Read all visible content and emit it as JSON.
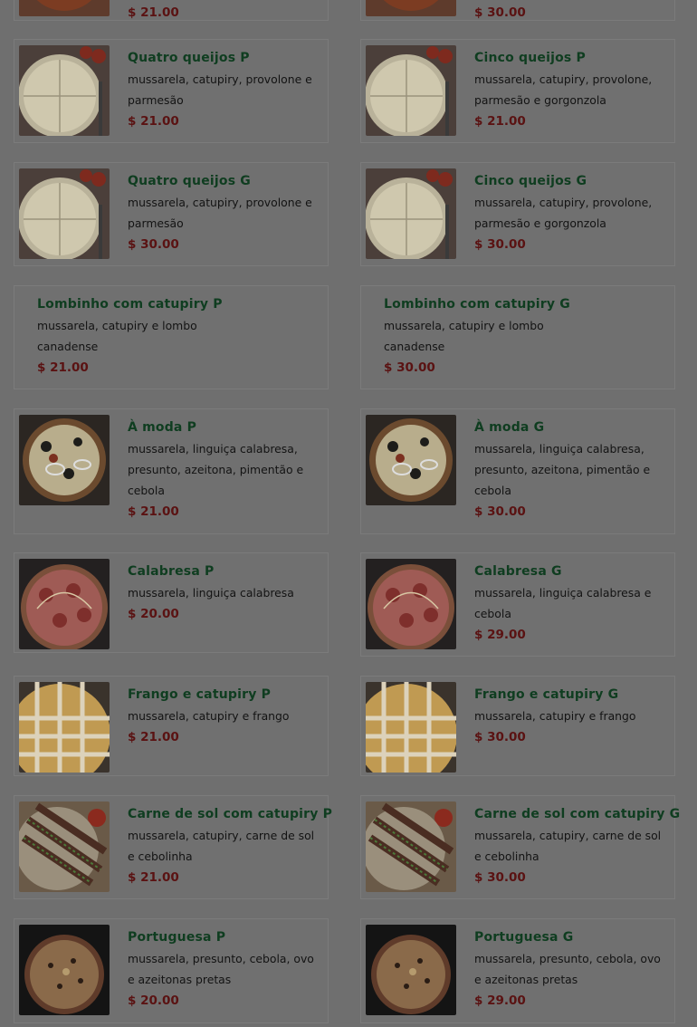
{
  "menu": {
    "items": [
      {
        "name": "",
        "desc": "",
        "price": "$ 21.00",
        "image": "pizza-tomato"
      },
      {
        "name": "",
        "desc": "",
        "price": "$ 30.00",
        "image": "pizza-tomato"
      },
      {
        "name": "Quatro queijos P",
        "desc": "mussarela, catupiry, provolone e parmesão",
        "price": "$ 21.00",
        "image": "pizza-cheese"
      },
      {
        "name": "Cinco queijos P",
        "desc": "mussarela, catupiry, provolone, parmesão e gorgonzola",
        "price": "$ 21.00",
        "image": "pizza-cheese"
      },
      {
        "name": "Quatro queijos G",
        "desc": "mussarela, catupiry, provolone e parmesão",
        "price": "$ 30.00",
        "image": "pizza-cheese"
      },
      {
        "name": "Cinco queijos G",
        "desc": "mussarela, catupiry, provolone, parmesão e gorgonzola",
        "price": "$ 30.00",
        "image": "pizza-cheese"
      },
      {
        "name": "Lombinho com catupiry P",
        "desc": "mussarela, catupiry e lombo canadense",
        "price": "$ 21.00",
        "image": ""
      },
      {
        "name": "Lombinho com catupiry G",
        "desc": "mussarela, catupiry e lombo canadense",
        "price": "$ 30.00",
        "image": ""
      },
      {
        "name": "À moda P",
        "desc": "mussarela, linguiça calabresa, presunto, azeitona, pimentão e cebola",
        "price": "$ 21.00",
        "image": "pizza-moda"
      },
      {
        "name": "À moda G",
        "desc": "mussarela, linguiça calabresa, presunto, azeitona, pimentão e cebola",
        "price": "$ 30.00",
        "image": "pizza-moda"
      },
      {
        "name": "Calabresa P",
        "desc": "mussarela, linguiça calabresa",
        "price": "$ 20.00",
        "image": "pizza-calabresa"
      },
      {
        "name": "Calabresa G",
        "desc": "mussarela, linguiça calabresa e cebola",
        "price": "$ 29.00",
        "image": "pizza-calabresa"
      },
      {
        "name": "Frango e catupiry P",
        "desc": "mussarela, catupiry e frango",
        "price": "$ 21.00",
        "image": "pizza-frango"
      },
      {
        "name": "Frango e catupiry G",
        "desc": "mussarela, catupiry e frango",
        "price": "$ 30.00",
        "image": "pizza-frango"
      },
      {
        "name": "Carne de sol com catupiry P",
        "desc": "mussarela, catupiry, carne de sol e cebolinha",
        "price": "$ 21.00",
        "image": "pizza-carne"
      },
      {
        "name": "Carne de sol com catupiry G",
        "desc": "mussarela, catupiry, carne de sol e cebolinha",
        "price": "$ 30.00",
        "image": "pizza-carne"
      },
      {
        "name": "Portuguesa P",
        "desc": "mussarela, presunto, cebola, ovo e azeitonas pretas",
        "price": "$ 20.00",
        "image": "pizza-portuguesa"
      },
      {
        "name": "Portuguesa G",
        "desc": "mussarela, presunto, cebola, ovo e azeitonas pretas",
        "price": "$ 29.00",
        "image": "pizza-portuguesa"
      }
    ]
  },
  "colors": {
    "overlay_bg": "#6f6f6f",
    "name": "#0f3d20",
    "price": "#5a1212",
    "desc": "#131313"
  }
}
